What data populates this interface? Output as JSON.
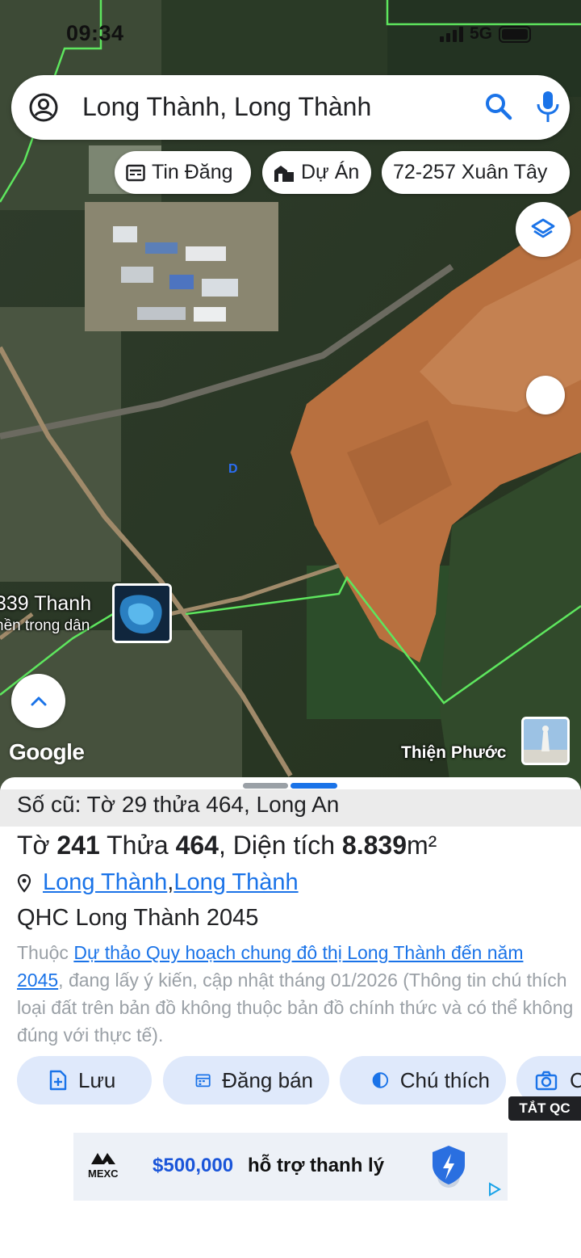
{
  "status_bar": {
    "time": "09:34",
    "network": "5G"
  },
  "search": {
    "query": "Long Thành, Long Thành"
  },
  "chips": [
    {
      "label": "Tin Đăng",
      "icon": "newspaper-icon"
    },
    {
      "label": "Dự Án",
      "icon": "buildings-icon"
    },
    {
      "label": "72-257 Xuân Tây",
      "icon": ""
    }
  ],
  "map": {
    "poi_title": "339 Thanh",
    "poi_subtitle": "hền trong dân",
    "logo": "Google",
    "place_label": "Thiện Phước",
    "parcel_marker": "D"
  },
  "sheet": {
    "old_number": "Số cũ: Tờ 29 thửa 464, Long An",
    "parcel_prefix": "Tờ ",
    "sheet_no": "241",
    "parcel_mid": " Thửa ",
    "parcel_no": "464",
    "area_label": ", Diện tích ",
    "area_value": "8.839",
    "area_unit": "m²",
    "location_district": "Long Thành",
    "location_sep": ", ",
    "location_province": "Long Thành",
    "plan_name": "QHC Long Thành 2045",
    "desc_prefix": "Thuộc ",
    "desc_link": "Dự thảo Quy hoạch chung đô thị Long Thành đến năm 2045",
    "desc_rest": ", đang lấy ý kiến, cập nhật tháng 01/2026 (Thông tin chú thích loại đất trên bản đồ không thuộc bản đồ chính thức và có thể không đúng với thực tế)."
  },
  "actions": [
    {
      "label": "Lưu",
      "icon": "save-file-icon"
    },
    {
      "label": "Đăng bán",
      "icon": "calendar-icon"
    },
    {
      "label": "Chú thích",
      "icon": "contrast-icon"
    },
    {
      "label": "C",
      "icon": "camera-icon"
    }
  ],
  "ad": {
    "close_label": "TẮT QC",
    "brand": "MEXC",
    "amount": "$500,000",
    "text": "hỗ trợ thanh lý"
  },
  "colors": {
    "accent": "#1a73e8",
    "chip_bg": "#dfe9fb",
    "boundary": "#5ee65e",
    "construction": "#b8703f"
  }
}
